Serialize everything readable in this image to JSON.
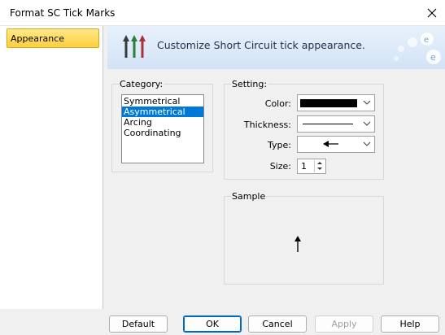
{
  "window": {
    "title": "Format SC Tick Marks",
    "close_icon": "close-icon"
  },
  "sidebar": {
    "items": [
      {
        "label": "Appearance",
        "selected": true
      }
    ]
  },
  "banner": {
    "text": "Customize Short Circuit tick appearance.",
    "icon": "tick-marks-icon"
  },
  "category": {
    "label": "Category:",
    "items": [
      "Symmetrical",
      "Asymmetrical",
      "Arcing",
      "Coordinating"
    ],
    "selected": "Asymmetrical"
  },
  "setting": {
    "label": "Setting:",
    "color_label": "Color:",
    "color_value": "#000000",
    "thickness_label": "Thickness:",
    "type_label": "Type:",
    "type_icon": "arrow-left-icon",
    "size_label": "Size:",
    "size_value": "1"
  },
  "sample": {
    "label": "Sample",
    "icon": "arrow-up-icon"
  },
  "buttons": {
    "default": "Default",
    "ok": "OK",
    "cancel": "Cancel",
    "apply": "Apply",
    "help": "Help"
  }
}
